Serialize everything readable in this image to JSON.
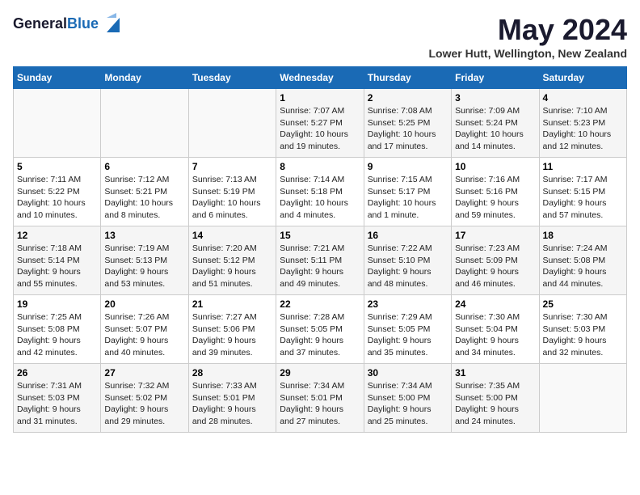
{
  "logo": {
    "general": "General",
    "blue": "Blue"
  },
  "title": "May 2024",
  "location": "Lower Hutt, Wellington, New Zealand",
  "days_of_week": [
    "Sunday",
    "Monday",
    "Tuesday",
    "Wednesday",
    "Thursday",
    "Friday",
    "Saturday"
  ],
  "weeks": [
    [
      {
        "day": "",
        "info": ""
      },
      {
        "day": "",
        "info": ""
      },
      {
        "day": "",
        "info": ""
      },
      {
        "day": "1",
        "info": "Sunrise: 7:07 AM\nSunset: 5:27 PM\nDaylight: 10 hours\nand 19 minutes."
      },
      {
        "day": "2",
        "info": "Sunrise: 7:08 AM\nSunset: 5:25 PM\nDaylight: 10 hours\nand 17 minutes."
      },
      {
        "day": "3",
        "info": "Sunrise: 7:09 AM\nSunset: 5:24 PM\nDaylight: 10 hours\nand 14 minutes."
      },
      {
        "day": "4",
        "info": "Sunrise: 7:10 AM\nSunset: 5:23 PM\nDaylight: 10 hours\nand 12 minutes."
      }
    ],
    [
      {
        "day": "5",
        "info": "Sunrise: 7:11 AM\nSunset: 5:22 PM\nDaylight: 10 hours\nand 10 minutes."
      },
      {
        "day": "6",
        "info": "Sunrise: 7:12 AM\nSunset: 5:21 PM\nDaylight: 10 hours\nand 8 minutes."
      },
      {
        "day": "7",
        "info": "Sunrise: 7:13 AM\nSunset: 5:19 PM\nDaylight: 10 hours\nand 6 minutes."
      },
      {
        "day": "8",
        "info": "Sunrise: 7:14 AM\nSunset: 5:18 PM\nDaylight: 10 hours\nand 4 minutes."
      },
      {
        "day": "9",
        "info": "Sunrise: 7:15 AM\nSunset: 5:17 PM\nDaylight: 10 hours\nand 1 minute."
      },
      {
        "day": "10",
        "info": "Sunrise: 7:16 AM\nSunset: 5:16 PM\nDaylight: 9 hours\nand 59 minutes."
      },
      {
        "day": "11",
        "info": "Sunrise: 7:17 AM\nSunset: 5:15 PM\nDaylight: 9 hours\nand 57 minutes."
      }
    ],
    [
      {
        "day": "12",
        "info": "Sunrise: 7:18 AM\nSunset: 5:14 PM\nDaylight: 9 hours\nand 55 minutes."
      },
      {
        "day": "13",
        "info": "Sunrise: 7:19 AM\nSunset: 5:13 PM\nDaylight: 9 hours\nand 53 minutes."
      },
      {
        "day": "14",
        "info": "Sunrise: 7:20 AM\nSunset: 5:12 PM\nDaylight: 9 hours\nand 51 minutes."
      },
      {
        "day": "15",
        "info": "Sunrise: 7:21 AM\nSunset: 5:11 PM\nDaylight: 9 hours\nand 49 minutes."
      },
      {
        "day": "16",
        "info": "Sunrise: 7:22 AM\nSunset: 5:10 PM\nDaylight: 9 hours\nand 48 minutes."
      },
      {
        "day": "17",
        "info": "Sunrise: 7:23 AM\nSunset: 5:09 PM\nDaylight: 9 hours\nand 46 minutes."
      },
      {
        "day": "18",
        "info": "Sunrise: 7:24 AM\nSunset: 5:08 PM\nDaylight: 9 hours\nand 44 minutes."
      }
    ],
    [
      {
        "day": "19",
        "info": "Sunrise: 7:25 AM\nSunset: 5:08 PM\nDaylight: 9 hours\nand 42 minutes."
      },
      {
        "day": "20",
        "info": "Sunrise: 7:26 AM\nSunset: 5:07 PM\nDaylight: 9 hours\nand 40 minutes."
      },
      {
        "day": "21",
        "info": "Sunrise: 7:27 AM\nSunset: 5:06 PM\nDaylight: 9 hours\nand 39 minutes."
      },
      {
        "day": "22",
        "info": "Sunrise: 7:28 AM\nSunset: 5:05 PM\nDaylight: 9 hours\nand 37 minutes."
      },
      {
        "day": "23",
        "info": "Sunrise: 7:29 AM\nSunset: 5:05 PM\nDaylight: 9 hours\nand 35 minutes."
      },
      {
        "day": "24",
        "info": "Sunrise: 7:30 AM\nSunset: 5:04 PM\nDaylight: 9 hours\nand 34 minutes."
      },
      {
        "day": "25",
        "info": "Sunrise: 7:30 AM\nSunset: 5:03 PM\nDaylight: 9 hours\nand 32 minutes."
      }
    ],
    [
      {
        "day": "26",
        "info": "Sunrise: 7:31 AM\nSunset: 5:03 PM\nDaylight: 9 hours\nand 31 minutes."
      },
      {
        "day": "27",
        "info": "Sunrise: 7:32 AM\nSunset: 5:02 PM\nDaylight: 9 hours\nand 29 minutes."
      },
      {
        "day": "28",
        "info": "Sunrise: 7:33 AM\nSunset: 5:01 PM\nDaylight: 9 hours\nand 28 minutes."
      },
      {
        "day": "29",
        "info": "Sunrise: 7:34 AM\nSunset: 5:01 PM\nDaylight: 9 hours\nand 27 minutes."
      },
      {
        "day": "30",
        "info": "Sunrise: 7:34 AM\nSunset: 5:00 PM\nDaylight: 9 hours\nand 25 minutes."
      },
      {
        "day": "31",
        "info": "Sunrise: 7:35 AM\nSunset: 5:00 PM\nDaylight: 9 hours\nand 24 minutes."
      },
      {
        "day": "",
        "info": ""
      }
    ]
  ]
}
